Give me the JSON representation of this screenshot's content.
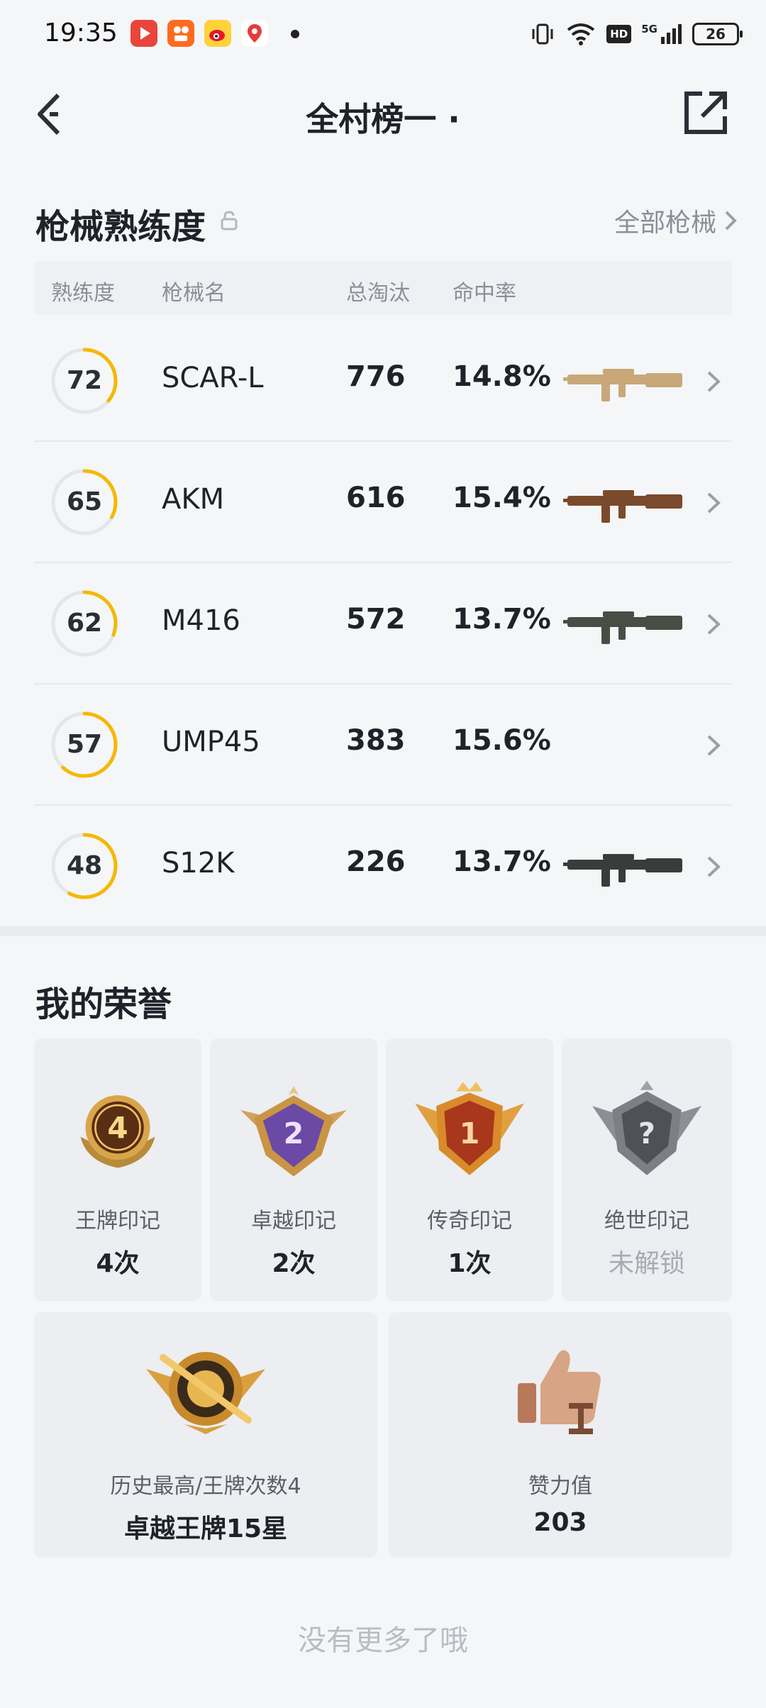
{
  "status_bar": {
    "time": "19:35",
    "battery": "26",
    "network": "5G",
    "hd": "HD",
    "app_icons": [
      "video-app-icon",
      "kuaishou-app-icon",
      "weibo-app-icon",
      "map-app-icon"
    ]
  },
  "header": {
    "title": "全村榜一 ·",
    "back_icon": "chevron-left-icon",
    "share_icon": "share-external-icon"
  },
  "weapons": {
    "title": "枪械熟练度",
    "lock_icon": "lock-open-icon",
    "all_link": "全部枪械",
    "columns": [
      "熟练度",
      "枪械名",
      "总淘汰",
      "命中率"
    ],
    "rows": [
      {
        "level": "72",
        "level_fraction": 0.36,
        "name": "SCAR-L",
        "kills": "776",
        "rate": "14.8%",
        "image": "scar-l-rifle-image",
        "color": "#c8a878"
      },
      {
        "level": "65",
        "level_fraction": 0.33,
        "name": "AKM",
        "kills": "616",
        "rate": "15.4%",
        "image": "akm-rifle-image",
        "color": "#7a4a2c"
      },
      {
        "level": "62",
        "level_fraction": 0.31,
        "name": "M416",
        "kills": "572",
        "rate": "13.7%",
        "image": "m416-rifle-image",
        "color": "#4a4d44"
      },
      {
        "level": "57",
        "level_fraction": 0.62,
        "name": "UMP45",
        "kills": "383",
        "rate": "15.6%",
        "image": "",
        "color": ""
      },
      {
        "level": "48",
        "level_fraction": 0.58,
        "name": "S12K",
        "kills": "226",
        "rate": "13.7%",
        "image": "s12k-shotgun-image",
        "color": "#3a3c3c"
      }
    ],
    "ring_color": "#f5b800",
    "ring_track": "#e4e6ea"
  },
  "honors": {
    "title": "我的荣誉",
    "badges": [
      {
        "label": "王牌印记",
        "value": "4次",
        "badge_text": "4",
        "icon": "ace-mark-badge-icon",
        "locked": false
      },
      {
        "label": "卓越印记",
        "value": "2次",
        "badge_text": "2",
        "icon": "excellence-mark-badge-icon",
        "locked": false
      },
      {
        "label": "传奇印记",
        "value": "1次",
        "badge_text": "1",
        "icon": "legend-mark-badge-icon",
        "locked": false
      },
      {
        "label": "绝世印记",
        "value": "未解锁",
        "badge_text": "?",
        "icon": "peerless-mark-badge-icon",
        "locked": true
      }
    ],
    "cards": [
      {
        "label": "历史最高/王牌次数4",
        "value": "卓越王牌15星",
        "icon": "highest-rank-badge-icon"
      },
      {
        "label": "赞力值",
        "value": "203",
        "icon": "thumbs-up-icon"
      }
    ]
  },
  "footer": "没有更多了哦"
}
